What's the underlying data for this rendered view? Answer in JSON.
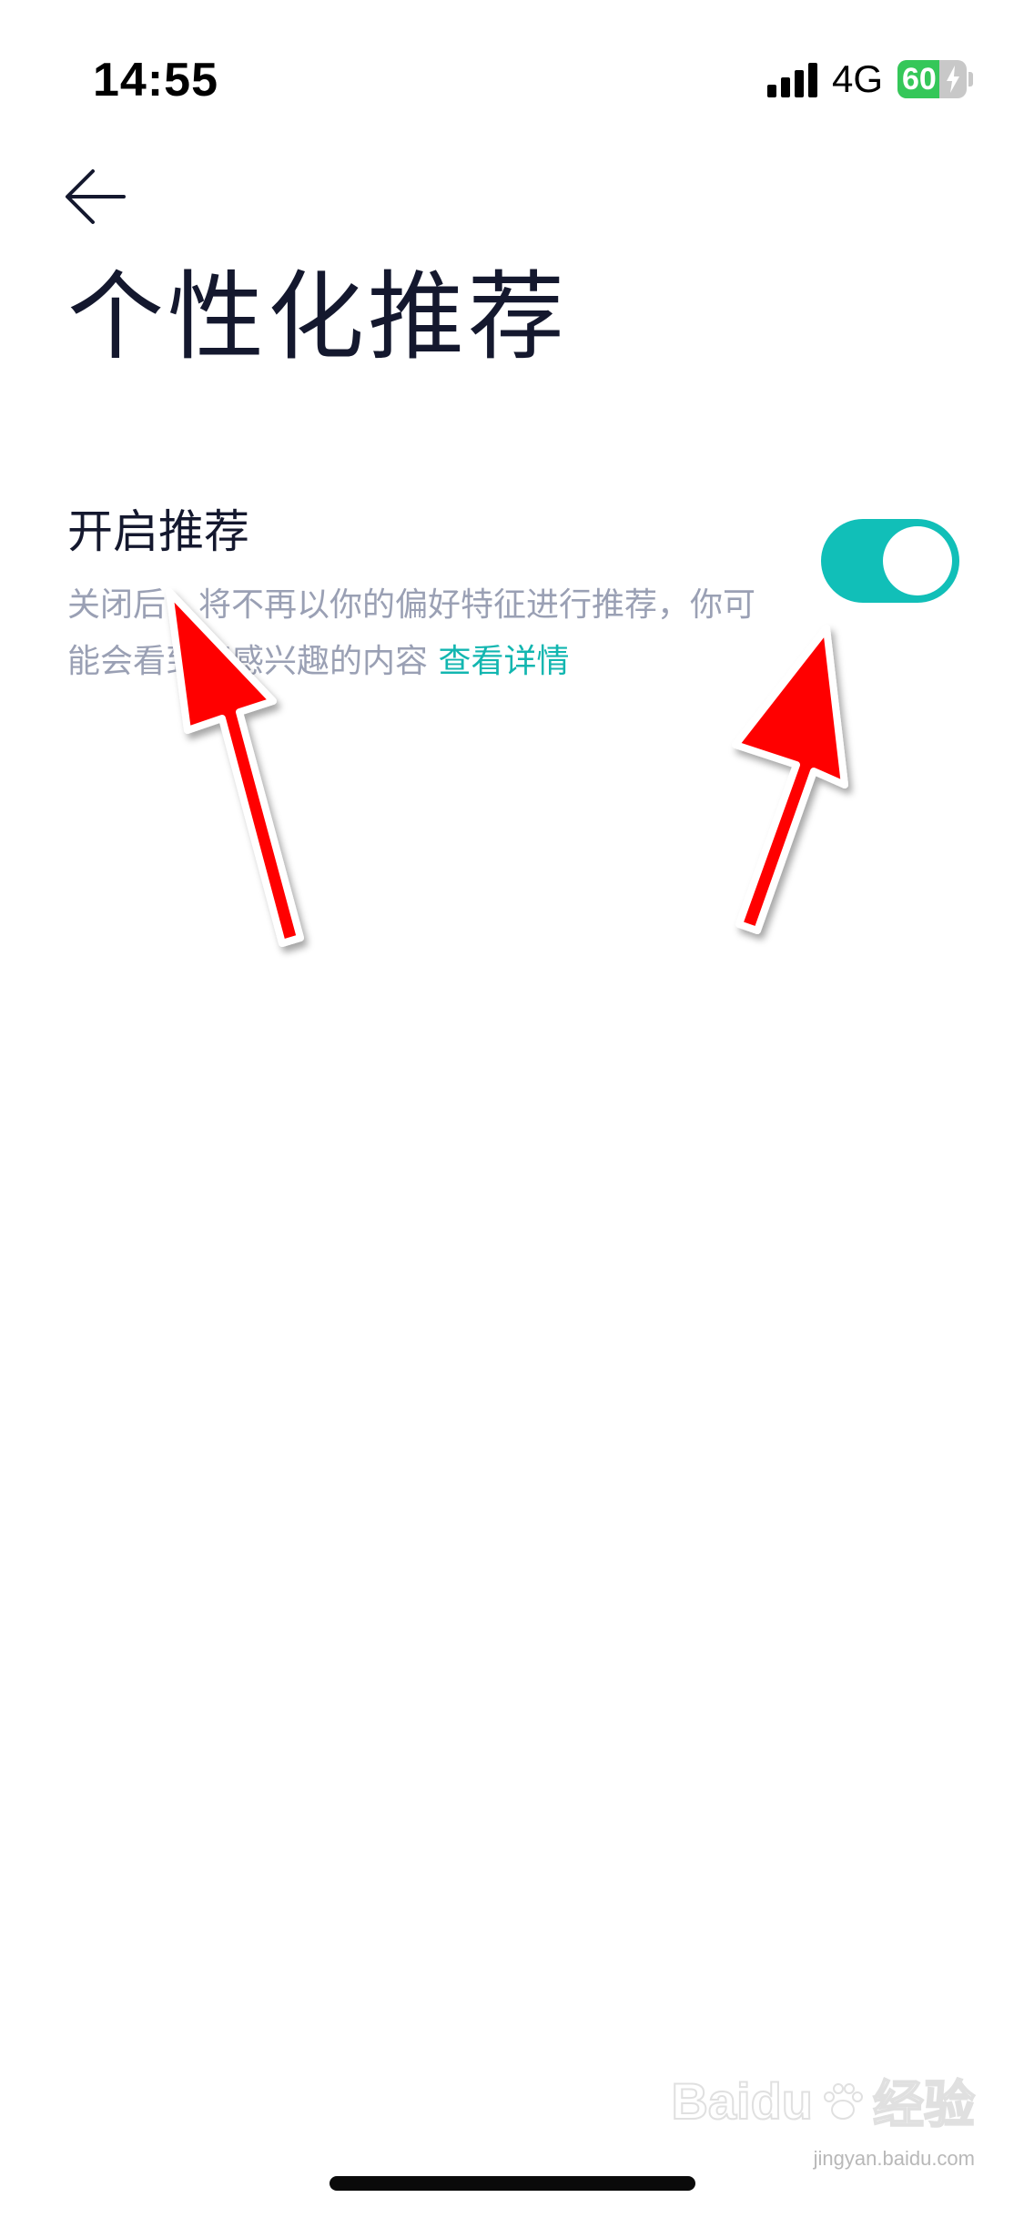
{
  "status_bar": {
    "time": "14:55",
    "network": "4G",
    "battery_level": "60",
    "battery_fraction": 0.6,
    "charging": true
  },
  "header": {
    "back_icon": "arrow-left-icon",
    "title": "个性化推荐"
  },
  "setting": {
    "label": "开启推荐",
    "description": "关闭后，将不再以你的偏好特征进行推荐，你可能会看到不感兴趣的内容",
    "link_text": "查看详情",
    "enabled": true,
    "accent_color": "#11bfb8"
  },
  "watermark": {
    "brand": "Baidu",
    "brand_suffix": "经验",
    "url": "jingyan.baidu.com"
  },
  "annotations": {
    "arrow_color": "#ff0000",
    "count": 2
  }
}
